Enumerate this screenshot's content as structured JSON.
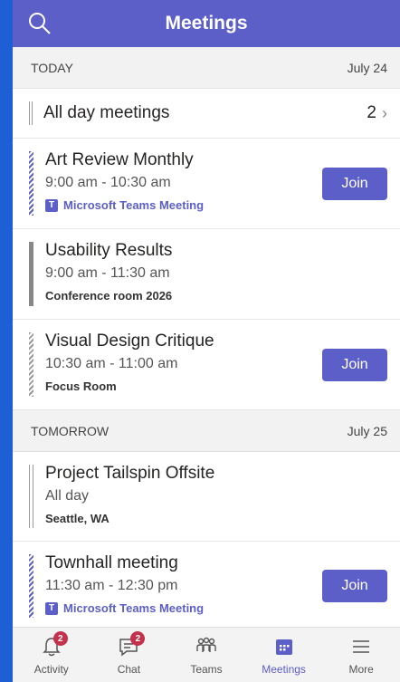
{
  "header": {
    "title": "Meetings"
  },
  "today": {
    "label": "TODAY",
    "date": "July 24"
  },
  "all_day": {
    "label": "All day meetings",
    "count": "2"
  },
  "meetings_today": [
    {
      "title": "Art Review Monthly",
      "time": "9:00 am - 10:30 am",
      "location": "Microsoft Teams Meeting",
      "join": "Join"
    },
    {
      "title": "Usability Results",
      "time": "9:00 am - 11:30 am",
      "location": "Conference room 2026"
    },
    {
      "title": "Visual Design Critique",
      "time": "10:30 am - 11:00 am",
      "location": "Focus Room",
      "join": "Join"
    }
  ],
  "tomorrow": {
    "label": "TOMORROW",
    "date": "July 25"
  },
  "meetings_tomorrow": [
    {
      "title": "Project Tailspin Offsite",
      "time": "All day",
      "location": "Seattle, WA"
    },
    {
      "title": "Townhall meeting",
      "time": "11:30 am - 12:30 pm",
      "location": "Microsoft Teams Meeting",
      "join": "Join"
    }
  ],
  "nav": [
    {
      "label": "Activity",
      "icon": "bell-icon",
      "badge": "2"
    },
    {
      "label": "Chat",
      "icon": "chat-icon",
      "badge": "2"
    },
    {
      "label": "Teams",
      "icon": "teams-icon"
    },
    {
      "label": "Meetings",
      "icon": "calendar-icon",
      "active": true
    },
    {
      "label": "More",
      "icon": "menu-icon"
    }
  ],
  "colors": {
    "brand": "#5b5fc7",
    "badge": "#c4314b",
    "background": "#1e5fd6"
  }
}
